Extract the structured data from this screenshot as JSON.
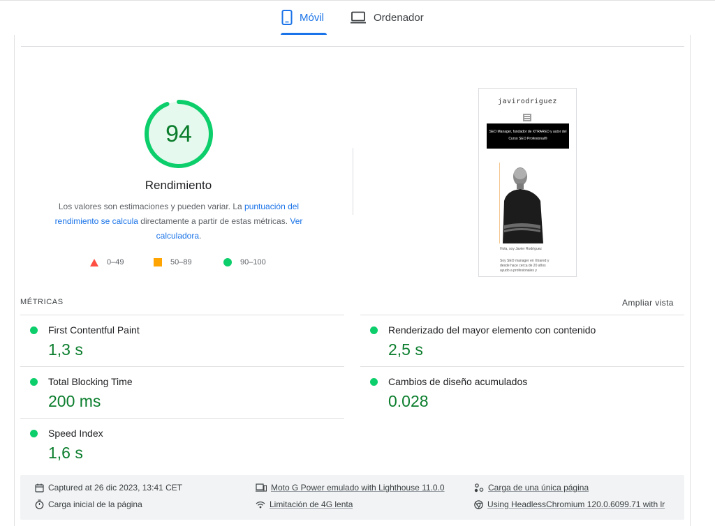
{
  "tabs": {
    "mobile_label": "Móvil",
    "desktop_label": "Ordenador",
    "active": "mobile"
  },
  "score": {
    "value": "94",
    "title": "Rendimiento",
    "desc_part1": "Los valores son estimaciones y pueden variar. La ",
    "desc_link1": "puntuación del rendimiento se calcula",
    "desc_part2": " directamente a partir de estas métricas. ",
    "desc_link2": "Ver calculadora",
    "desc_part3": ".",
    "ring_fraction": 0.94,
    "color_pass": "#0cce6b",
    "color_avg": "#ffa400",
    "color_fail": "#ff4e42"
  },
  "legend": {
    "fail": "0–49",
    "average": "50–89",
    "pass": "90–100"
  },
  "screenshot": {
    "logo": "javirodriguez",
    "banner": "SEO Manager, fundador de XTRARED y autor del Curso SEO Profesional®",
    "greeting": "Hola, soy Javier Rodríguez",
    "intro_1": "Soy SEO manager en Xtrared y",
    "intro_2": "desde hace cerca de 20 años",
    "intro_3": "ayudo a profesionales y"
  },
  "metrics": {
    "section_label": "MÉTRICAS",
    "expand_label": "Ampliar vista",
    "items": [
      {
        "name": "First Contentful Paint",
        "value": "1,3 s"
      },
      {
        "name": "Renderizado del mayor elemento con contenido",
        "value": "2,5 s"
      },
      {
        "name": "Total Blocking Time",
        "value": "200 ms"
      },
      {
        "name": "Cambios de diseño acumulados",
        "value": "0.028"
      },
      {
        "name": "Speed Index",
        "value": "1,6 s"
      }
    ]
  },
  "footer": {
    "captured": "Captured at 26 dic 2023, 13:41 CET",
    "initial_load": "Carga inicial de la página",
    "device": "Moto G Power emulado with Lighthouse 11.0.0",
    "throttling": "Limitación de 4G lenta",
    "session": "Carga de una única página",
    "browser": "Using HeadlessChromium 120.0.6099.71 with lr"
  }
}
